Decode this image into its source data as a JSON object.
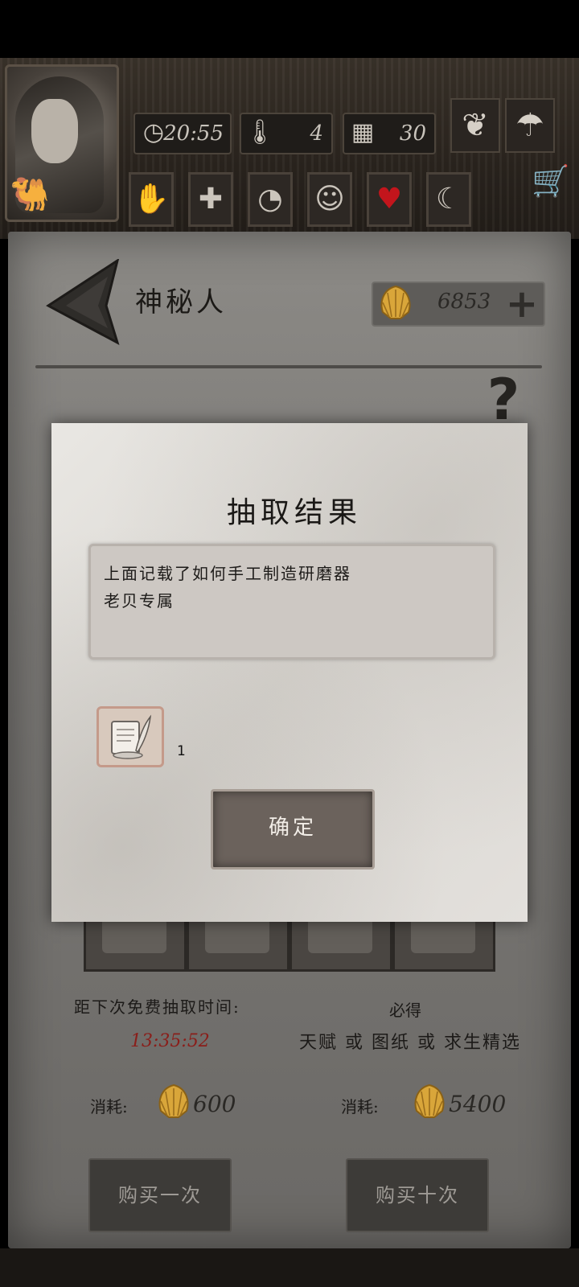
{
  "hud": {
    "time": "20:55",
    "temperature": "4",
    "day": "30",
    "icons": {
      "clock": "clock-icon",
      "thermometer": "thermometer-icon",
      "calendar": "calendar-icon",
      "weed": "cannabis-leaf-icon",
      "weather": "rain-cloud-icon",
      "camel": "camel-icon",
      "cart": "shopping-cart-icon"
    },
    "status_slots": [
      "bandaged-hand-icon",
      "medical-cross-icon",
      "stomach-icon",
      "head-icon",
      "heart-icon",
      "moon-star-icon"
    ],
    "heart_color": "#c3151c"
  },
  "merchant": {
    "title": "神秘人",
    "coins": "6853",
    "plus_label": "+",
    "help_label": "?"
  },
  "draw": {
    "free_label": "距下次免费抽取时间:",
    "free_timer": "13:35:52",
    "guarantee_label": "必得",
    "guarantee_items": "天赋 或 图纸 或 求生精选",
    "cost_label": "消耗:",
    "cost_single": "600",
    "cost_ten": "5400",
    "buy_once": "购买一次",
    "buy_ten": "购买十次"
  },
  "modal": {
    "title": "抽取结果",
    "result_lines": [
      "上面记载了如何手工制造研磨器",
      "老贝专属"
    ],
    "item_icon": "blueprint-scroll-icon",
    "item_count": "1",
    "confirm": "确定"
  }
}
